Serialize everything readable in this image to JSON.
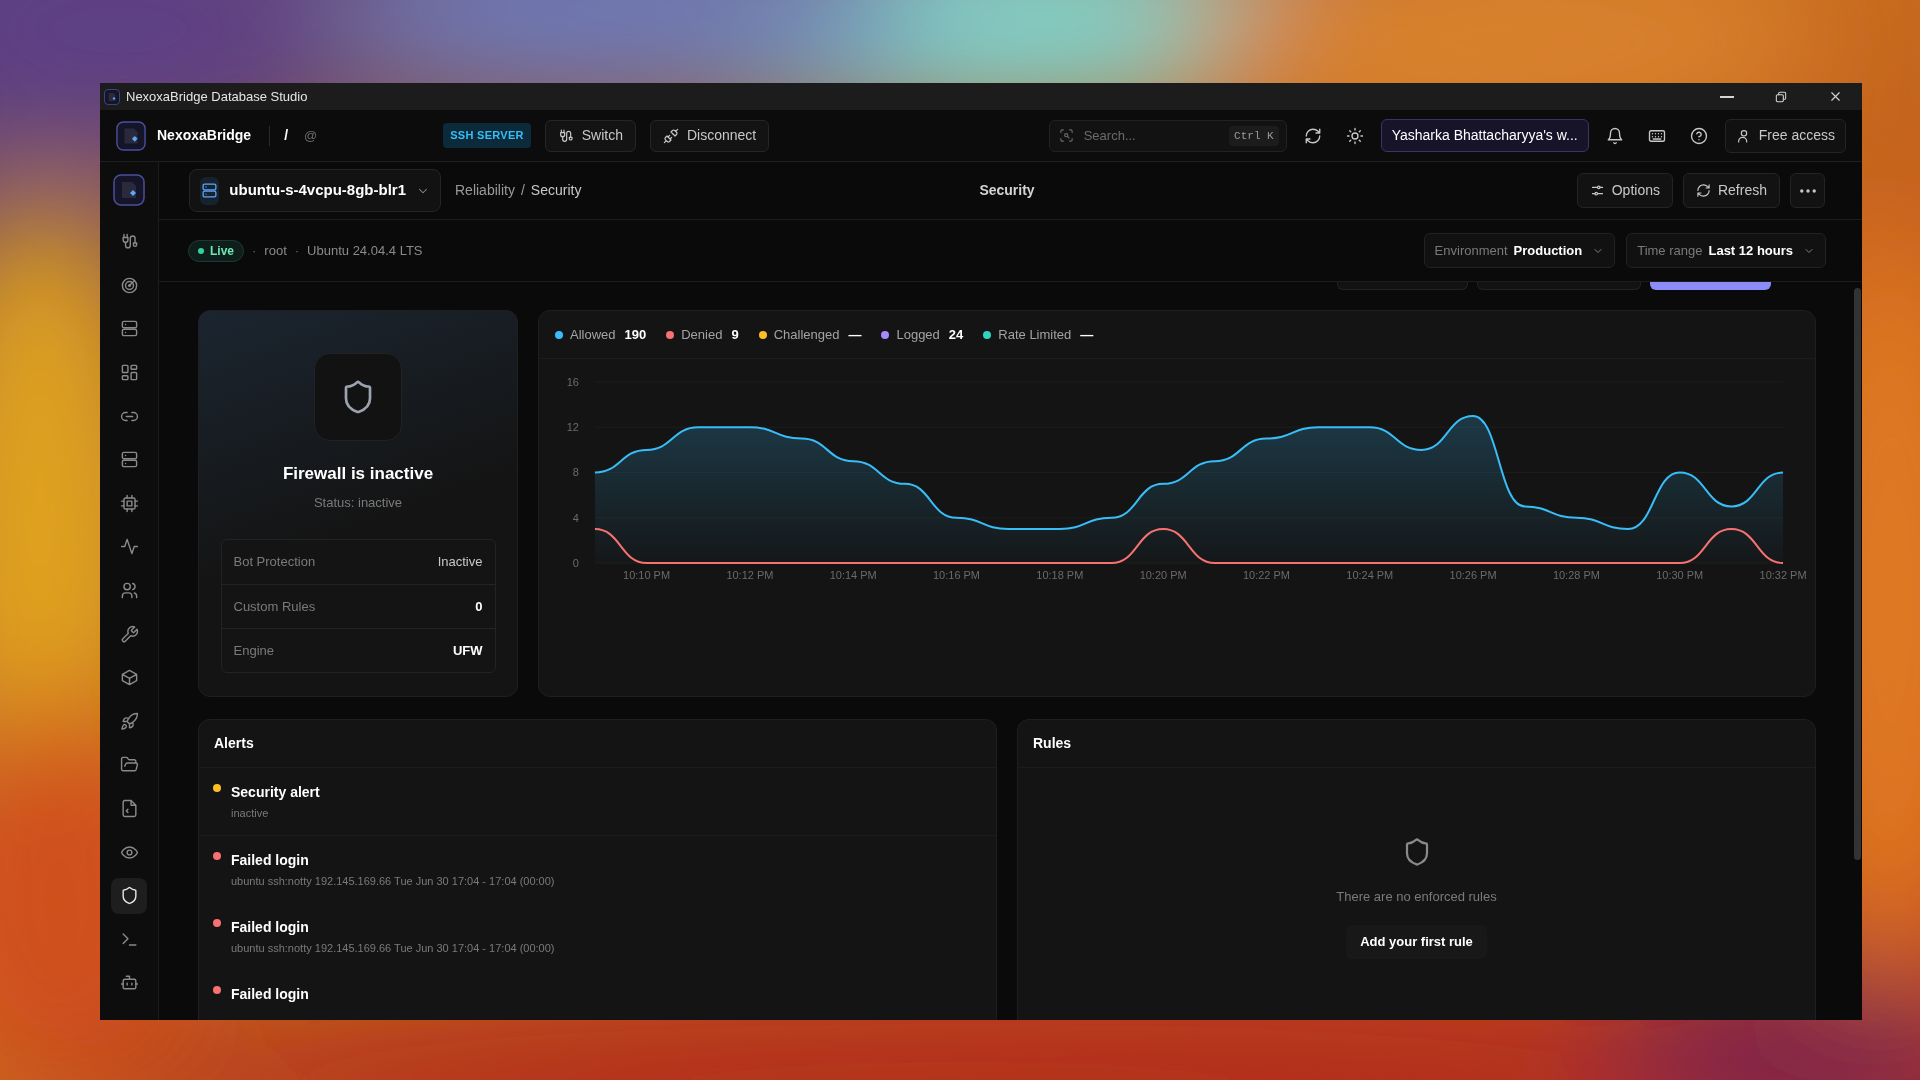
{
  "window": {
    "title": "NexoxaBridge Database Studio"
  },
  "topbar": {
    "brand": "NexoxaBridge",
    "separator": "/",
    "at": "@",
    "badge": "SSH SERVER",
    "buttons": [
      {
        "label": "Switch",
        "kind": "switch"
      },
      {
        "label": "Disconnect",
        "kind": "disconnect"
      }
    ],
    "search": {
      "placeholder": "Search...",
      "shortcut": "Ctrl K"
    },
    "workspace": "Yasharka Bhattacharyya's w...",
    "account": "Free access"
  },
  "sidebar": {
    "items": [
      {
        "selected": false
      },
      {
        "selected": false
      },
      {
        "selected": false
      },
      {
        "selected": false
      },
      {
        "selected": false
      },
      {
        "selected": false
      },
      {
        "selected": false
      },
      {
        "selected": false
      },
      {
        "selected": false
      },
      {
        "selected": false
      },
      {
        "selected": false
      },
      {
        "selected": false
      },
      {
        "selected": false
      },
      {
        "selected": false
      },
      {
        "selected": false
      },
      {
        "selected": false
      },
      {
        "selected": true
      },
      {
        "selected": false
      },
      {
        "selected": false
      }
    ]
  },
  "header": {
    "server": "ubuntu-s-4vcpu-8gb-blr1",
    "breadcrumb": [
      "Reliability",
      "/",
      "Security"
    ],
    "title": "Security",
    "buttons": [
      {
        "kind": "options",
        "label": "Options"
      },
      {
        "kind": "refresh",
        "label": "Refresh"
      },
      {
        "kind": "more"
      }
    ]
  },
  "status": {
    "badge": "Live",
    "meta": [
      {
        "sep": "·",
        "text": "root"
      },
      {
        "sep": "·",
        "text": "Ubuntu 24.04.4 LTS"
      }
    ],
    "filters": [
      {
        "label": "Environment",
        "value": "Production"
      },
      {
        "label": "Time range",
        "value": "Last 12 hours"
      }
    ]
  },
  "strip": [
    {
      "selected": false
    },
    {
      "selected": false
    },
    {
      "selected": true
    }
  ],
  "firewall": {
    "title": "Firewall is inactive",
    "status": "Status: inactive",
    "rows": [
      {
        "label": "Bot Protection",
        "value": "Inactive"
      },
      {
        "label": "Custom Rules",
        "value": "0"
      },
      {
        "label": "Engine",
        "value": "UFW"
      }
    ]
  },
  "traffic": {
    "legend": [
      {
        "kind": "series",
        "value": "190"
      },
      {
        "kind": "series",
        "value": "9"
      },
      {
        "label": "Challenged",
        "value": "—",
        "color": "#fbbf24"
      },
      {
        "label": "Logged",
        "value": "24",
        "color": "#a78bfa"
      },
      {
        "label": "Rate Limited",
        "value": "—",
        "color": "#2dd4bf"
      }
    ],
    "chart_data": {
      "type": "area",
      "categories": [
        null,
        "10:10 PM",
        null,
        "10:12 PM",
        null,
        "10:14 PM",
        null,
        "10:16 PM",
        null,
        "10:18 PM",
        null,
        "10:20 PM",
        null,
        "10:22 PM",
        null,
        "10:24 PM",
        null,
        "10:26 PM",
        null,
        "10:28 PM",
        null,
        "10:30 PM",
        null,
        "10:32 PM"
      ],
      "ylim": [
        0,
        16
      ],
      "yticks": [
        0,
        4,
        8,
        12,
        16
      ],
      "grid": true,
      "series": [
        {
          "name": "Allowed",
          "color": "#38bdf8",
          "values": [
            8,
            10,
            12,
            12,
            11,
            9,
            7,
            4,
            3,
            3,
            4,
            7,
            9,
            11,
            12,
            12,
            10,
            13,
            5,
            4,
            3,
            8,
            5,
            8
          ]
        },
        {
          "name": "Denied",
          "type": "line",
          "color": "#f87171",
          "values": [
            3,
            0,
            0,
            0,
            0,
            0,
            0,
            0,
            0,
            0,
            0,
            3,
            0,
            0,
            0,
            0,
            0,
            0,
            0,
            0,
            0,
            0,
            3,
            0
          ]
        }
      ]
    }
  },
  "alerts": {
    "title": "Alerts",
    "items": [
      {
        "title": "Security alert",
        "detail": "inactive",
        "color": "#fbbf24"
      },
      {
        "title": "Failed login",
        "detail": "ubuntu ssh:notty 192.145.169.66 Tue Jun 30 17:04 - 17:04 (00:00)",
        "color": "#f87171"
      },
      {
        "title": "Failed login",
        "detail": "ubuntu ssh:notty 192.145.169.66 Tue Jun 30 17:04 - 17:04 (00:00)",
        "color": "#f87171"
      },
      {
        "title": "Failed login",
        "color": "#f87171"
      }
    ]
  },
  "rules": {
    "title": "Rules",
    "empty_text": "There are no enforced rules",
    "action": "Add your first rule"
  }
}
